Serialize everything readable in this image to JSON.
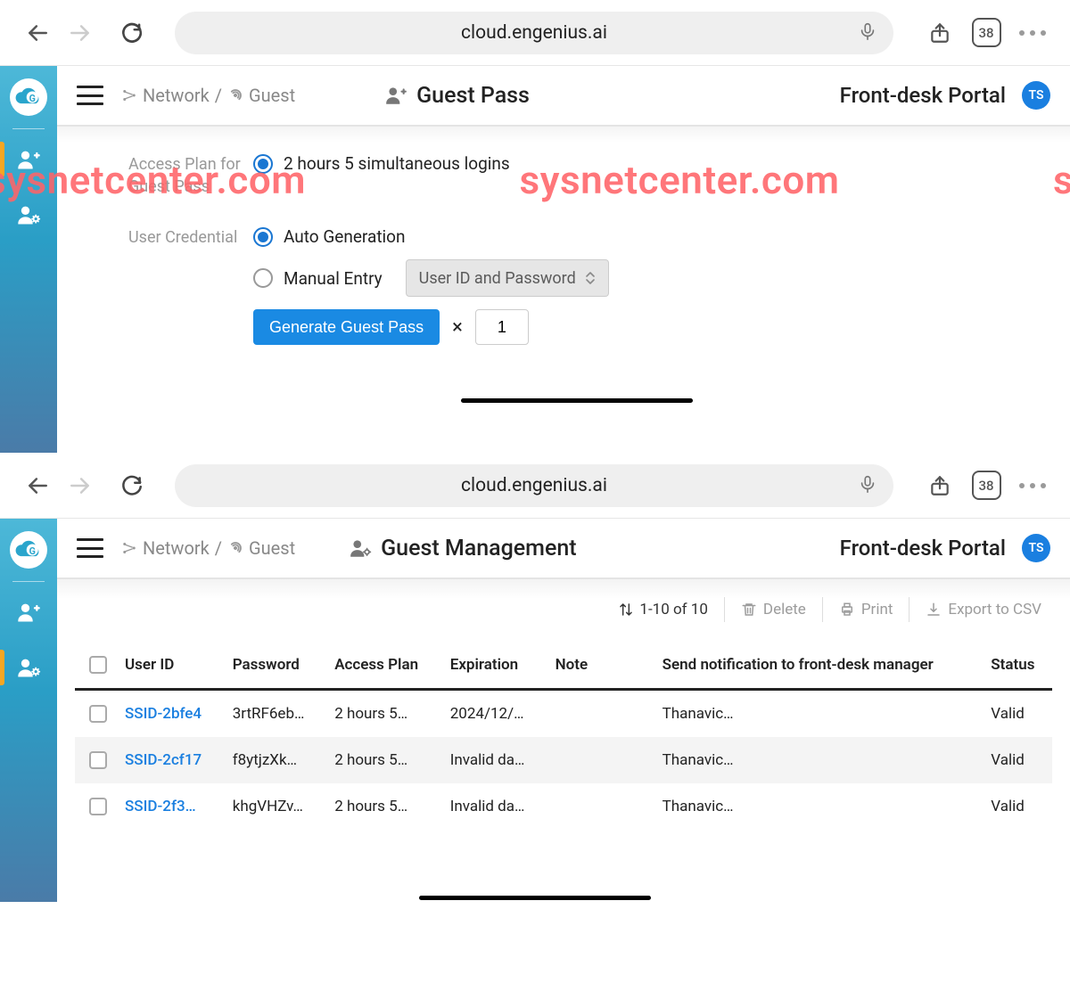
{
  "browser": {
    "url": "cloud.engenius.ai",
    "tab_count": "38"
  },
  "watermark": "sysnetcenter.com",
  "screen1": {
    "breadcrumb": {
      "network": "Network",
      "sep": "/",
      "guest": "Guest"
    },
    "page_title": "Guest Pass",
    "portal_label": "Front-desk Portal",
    "avatar": "TS",
    "access_plan_label": "Access Plan for Guest Pass",
    "access_plan_option": "2 hours 5 simultaneous logins",
    "user_credential_label": "User Credential",
    "auto_gen_label": "Auto Generation",
    "manual_entry_label": "Manual Entry",
    "credential_select": "User ID and Password",
    "generate_button": "Generate Guest Pass",
    "times_char": "×",
    "quantity": "1"
  },
  "screen2": {
    "breadcrumb": {
      "network": "Network",
      "sep": "/",
      "guest": "Guest"
    },
    "page_title": "Guest Management",
    "portal_label": "Front-desk Portal",
    "avatar": "TS",
    "pagination": "1-10 of 10",
    "delete_label": "Delete",
    "print_label": "Print",
    "export_label": "Export to CSV",
    "columns": {
      "user_id": "User ID",
      "password": "Password",
      "access_plan": "Access Plan",
      "expiration": "Expiration",
      "note": "Note",
      "notify": "Send notification to front-desk manager",
      "status": "Status"
    },
    "rows": [
      {
        "user_id": "SSID-2bfe4",
        "password": "3rtRF6eb…",
        "plan": "2 hours 5…",
        "exp": "2024/12/…",
        "note": "",
        "notify": "Thanavic…",
        "status": "Valid"
      },
      {
        "user_id": "SSID-2cf17",
        "password": "f8ytjzXk…",
        "plan": "2 hours 5…",
        "exp": "Invalid da…",
        "note": "",
        "notify": "Thanavic…",
        "status": "Valid"
      },
      {
        "user_id": "SSID-2f3…",
        "password": "khgVHZv…",
        "plan": "2 hours 5…",
        "exp": "Invalid da…",
        "note": "",
        "notify": "Thanavic…",
        "status": "Valid"
      }
    ]
  }
}
